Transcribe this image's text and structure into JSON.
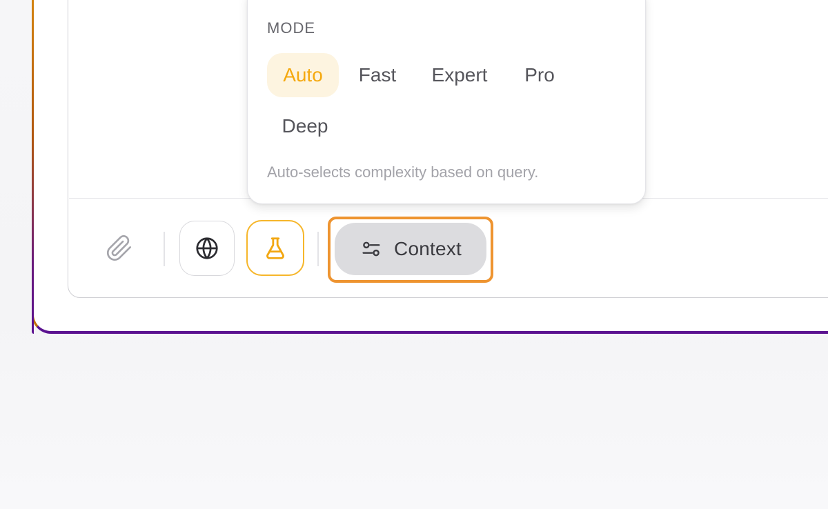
{
  "mode_popover": {
    "heading": "MODE",
    "options": [
      {
        "label": "Auto",
        "selected": true
      },
      {
        "label": "Fast",
        "selected": false
      },
      {
        "label": "Expert",
        "selected": false
      },
      {
        "label": "Pro",
        "selected": false
      },
      {
        "label": "Deep",
        "selected": false
      }
    ],
    "description": "Auto-selects complexity based on query."
  },
  "toolbar": {
    "attach_icon": "paperclip-icon",
    "web_icon": "globe-icon",
    "lab_icon": "flask-icon",
    "context_icon": "sliders-icon",
    "context_label": "Context"
  },
  "colors": {
    "accent": "#f5a90f",
    "selected_bg": "#fdf4e0",
    "highlight": "#ee9430",
    "frame_top": "#d98a10",
    "frame_bottom": "#5b1290"
  }
}
